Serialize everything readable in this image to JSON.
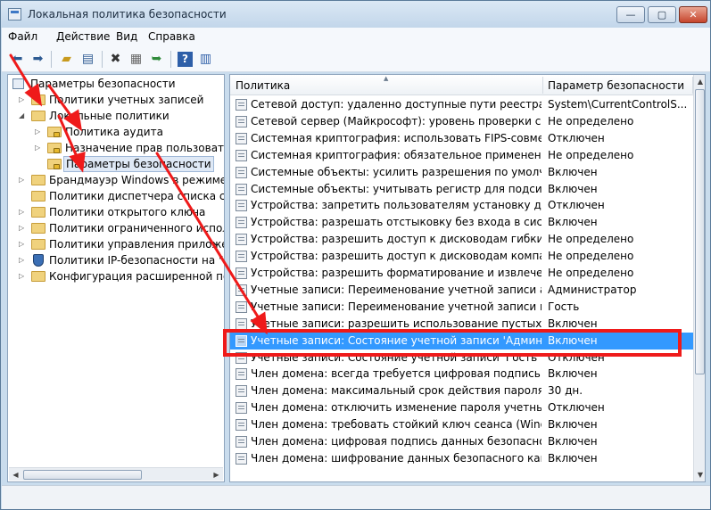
{
  "window": {
    "title": "Локальная политика безопасности",
    "controls": {
      "minimize": "—",
      "maximize": "▢",
      "close": "✕"
    }
  },
  "menu": [
    "Файл",
    "Действие",
    "Вид",
    "Справка"
  ],
  "tree": {
    "root": "Параметры безопасности",
    "items": [
      {
        "label": "Политики учетных записей",
        "expanded": false
      },
      {
        "label": "Локальные политики",
        "expanded": true
      },
      {
        "label": "Политика аудита",
        "expanded": false
      },
      {
        "label": "Назначение прав пользователя",
        "expanded": false
      },
      {
        "label": "Параметры безопасности",
        "selected": true
      },
      {
        "label": "Брандмауэр Windows в режиме пов",
        "expanded": false
      },
      {
        "label": "Политики диспетчера списка сетей"
      },
      {
        "label": "Политики открытого ключа",
        "expanded": false
      },
      {
        "label": "Политики ограниченного использо",
        "expanded": false
      },
      {
        "label": "Политики управления приложения",
        "expanded": false
      },
      {
        "label": "Политики IP-безопасности на \"Лока",
        "expanded": false
      },
      {
        "label": "Конфигурация расширенной полити",
        "expanded": false
      }
    ]
  },
  "list": {
    "columns": {
      "policy": "Политика",
      "setting": "Параметр безопасности"
    },
    "rows": [
      {
        "policy": "Сетевой доступ: удаленно доступные пути реестра",
        "setting": "System\\CurrentControlS..."
      },
      {
        "policy": "Сетевой сервер (Майкрософт): уровень проверки сервер...",
        "setting": "Не определено"
      },
      {
        "policy": "Системная криптография: использовать FIPS-совместим...",
        "setting": "Отключен"
      },
      {
        "policy": "Системная криптография: обязательное применение си...",
        "setting": "Не определено"
      },
      {
        "policy": "Системные объекты: усилить разрешения по умолчани...",
        "setting": "Включен"
      },
      {
        "policy": "Системные объекты: учитывать регистр для подсистем, ...",
        "setting": "Включен"
      },
      {
        "policy": "Устройства: запретить пользователям установку драйвер...",
        "setting": "Отключен"
      },
      {
        "policy": "Устройства: разрешать отстыковку без входа в систему",
        "setting": "Включен"
      },
      {
        "policy": "Устройства: разрешить доступ к дисководам гибких диск...",
        "setting": "Не определено"
      },
      {
        "policy": "Устройства: разрешить доступ к дисководам компакт-ди...",
        "setting": "Не определено"
      },
      {
        "policy": "Устройства: разрешить форматирование и извлечение с...",
        "setting": "Не определено"
      },
      {
        "policy": "Учетные записи: Переименование учетной записи админ...",
        "setting": "Администратор"
      },
      {
        "policy": "Учетные записи: Переименование учетной записи гостя",
        "setting": "Гость"
      },
      {
        "policy": "Учетные записи: разрешить использование пустых паро...",
        "setting": "Включен"
      },
      {
        "policy": "Учетные записи: Состояние учетной записи 'Администра...",
        "setting": "Включен",
        "selected": true
      },
      {
        "policy": "Учетные записи: Состояние учетной записи 'Гость'",
        "setting": "Отключен"
      },
      {
        "policy": "Член домена: всегда требуется цифровая подпись или ш...",
        "setting": "Включен"
      },
      {
        "policy": "Член домена: максимальный срок действия пароля учет...",
        "setting": "30 дн."
      },
      {
        "policy": "Член домена: отключить изменение пароля учетных запи...",
        "setting": "Отключен"
      },
      {
        "policy": "Член домена: требовать стойкий ключ сеанса (Windows ...",
        "setting": "Включен"
      },
      {
        "policy": "Член домена: цифровая подпись данных безопасного ка...",
        "setting": "Включен"
      },
      {
        "policy": "Член домена: шифрование данных безопасного канала, ...",
        "setting": "Включен"
      }
    ]
  },
  "icons": {
    "back": "back-arrow-icon",
    "forward": "forward-arrow-icon",
    "up": "up-folder-icon",
    "show-tree": "show-hide-tree-icon",
    "delete": "delete-icon",
    "properties": "properties-icon",
    "export": "export-list-icon",
    "help": "help-icon",
    "view": "view-icon"
  },
  "annotation": {
    "color": "#ef1a1a"
  }
}
